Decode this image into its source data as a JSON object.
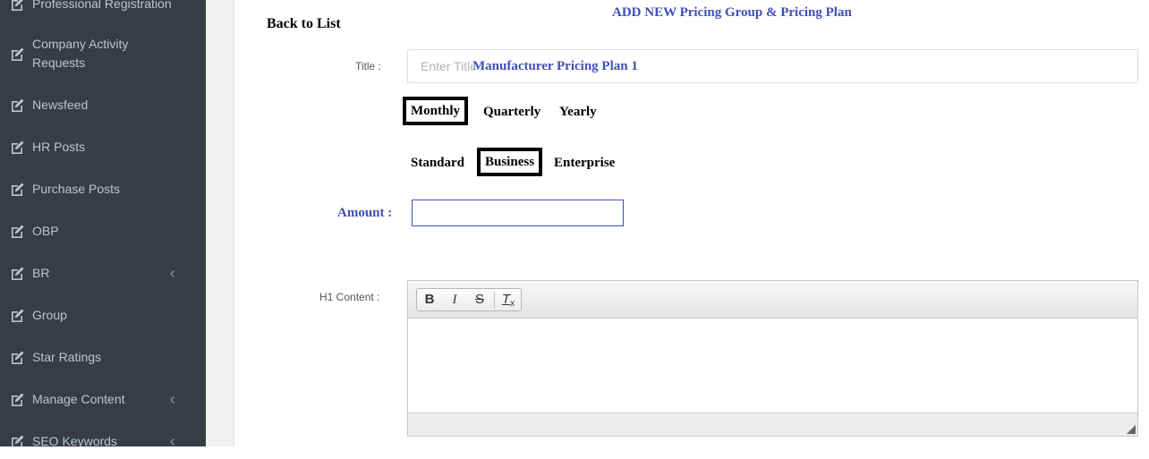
{
  "sidebar": {
    "items": [
      {
        "label": "Professional Registration",
        "icon": "edit-icon",
        "has_children": false
      },
      {
        "label": "Company Activity Requests",
        "icon": "edit-icon",
        "has_children": false
      },
      {
        "label": "Newsfeed",
        "icon": "edit-icon",
        "has_children": false
      },
      {
        "label": "HR Posts",
        "icon": "edit-icon",
        "has_children": false
      },
      {
        "label": "Purchase Posts",
        "icon": "edit-icon",
        "has_children": false
      },
      {
        "label": "OBP",
        "icon": "edit-icon",
        "has_children": false
      },
      {
        "label": "BR",
        "icon": "edit-icon",
        "has_children": true
      },
      {
        "label": "Group",
        "icon": "edit-icon",
        "has_children": false
      },
      {
        "label": "Star Ratings",
        "icon": "edit-icon",
        "has_children": false
      },
      {
        "label": "Manage Content",
        "icon": "edit-icon",
        "has_children": true
      },
      {
        "label": "SEO Keywords",
        "icon": "edit-icon",
        "has_children": true
      }
    ]
  },
  "header": {
    "title": "ADD NEW Pricing Group & Pricing Plan",
    "back_link": "Back to List"
  },
  "form": {
    "title_label": "Title :",
    "title_placeholder": "Enter Title",
    "title_value": "Manufacturer Pricing Plan  1",
    "period_options": [
      {
        "label": "Monthly",
        "selected": true
      },
      {
        "label": "Quarterly",
        "selected": false
      },
      {
        "label": "Yearly",
        "selected": false
      }
    ],
    "tier_options": [
      {
        "label": "Standard",
        "selected": false
      },
      {
        "label": "Business",
        "selected": true
      },
      {
        "label": "Enterprise",
        "selected": false
      }
    ],
    "amount_label": "Amount  :",
    "amount_value": "",
    "h1_label": "H1 Content :",
    "editor": {
      "bold": "B",
      "italic": "I",
      "strike": "S",
      "clear_format": "T",
      "clear_format_sub": "x"
    }
  },
  "colors": {
    "sidebar_bg": "#383c44",
    "sidebar_text": "#b8c7ce",
    "accent": "#3f4fb8"
  }
}
